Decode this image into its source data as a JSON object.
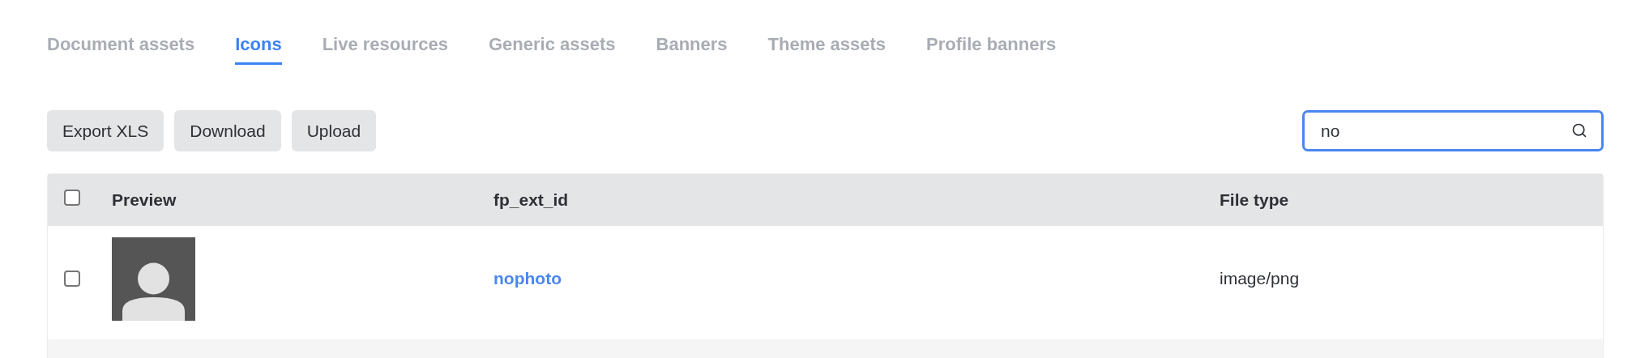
{
  "tabs": [
    {
      "label": "Document assets",
      "selected": false
    },
    {
      "label": "Icons",
      "selected": true
    },
    {
      "label": "Live resources",
      "selected": false
    },
    {
      "label": "Generic assets",
      "selected": false
    },
    {
      "label": "Banners",
      "selected": false
    },
    {
      "label": "Theme assets",
      "selected": false
    },
    {
      "label": "Profile banners",
      "selected": false
    }
  ],
  "toolbar": {
    "buttons": [
      "Export XLS",
      "Download",
      "Upload"
    ],
    "search": {
      "value": "no",
      "focused": true
    }
  },
  "table": {
    "header_checked": false,
    "columns": [
      "Preview",
      "fp_ext_id",
      "File type"
    ],
    "rows": [
      {
        "checked": false,
        "preview": {
          "kind": "avatar"
        },
        "fp_ext_id": "nophoto",
        "file_type": "image/png"
      }
    ]
  }
}
